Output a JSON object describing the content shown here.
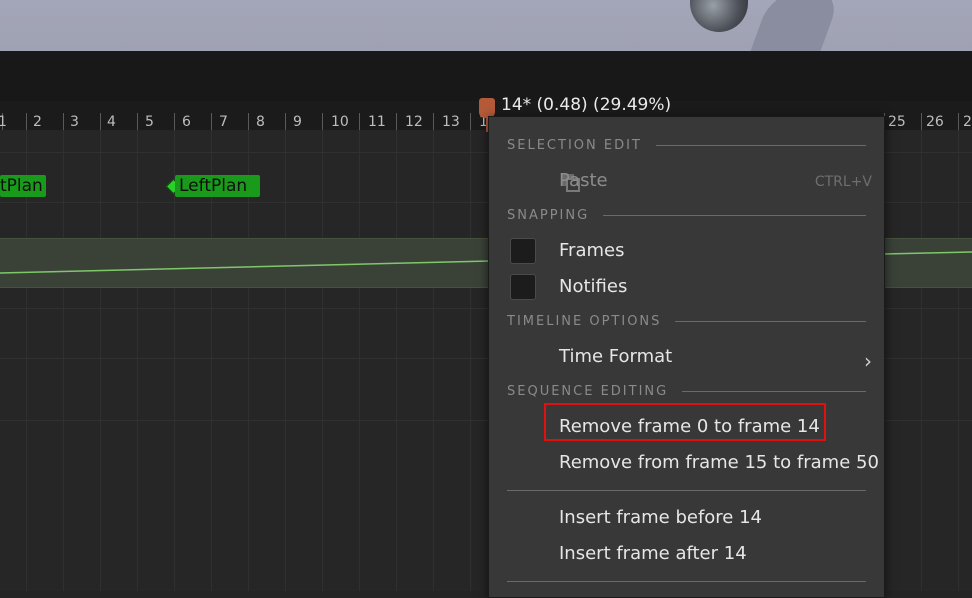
{
  "timeline": {
    "ruler_labels": [
      "1",
      "2",
      "3",
      "4",
      "5",
      "6",
      "7",
      "8",
      "9",
      "10",
      "11",
      "12",
      "13",
      "1",
      "25",
      "26",
      "2"
    ],
    "scrubber_readout": "14* (0.48) (29.49%)",
    "notifies": [
      "tPlan",
      "LeftPlan"
    ]
  },
  "menu": {
    "sections": {
      "selection_edit": "SELECTION EDIT",
      "snapping": "SNAPPING",
      "timeline_options": "TIMELINE OPTIONS",
      "sequence_editing": "SEQUENCE EDITING"
    },
    "paste": {
      "label": "Paste",
      "shortcut": "CTRL+V",
      "enabled": false
    },
    "snap_frames": {
      "label": "Frames",
      "checked": false
    },
    "snap_notifies": {
      "label": "Notifies",
      "checked": false
    },
    "time_format": "Time Format",
    "remove_frame_0_to_14": "Remove frame 0 to frame 14",
    "remove_from_15_to_50": "Remove from frame 15 to frame 50",
    "insert_before": "Insert frame before 14",
    "insert_after": "Insert frame after 14"
  },
  "colors": {
    "scrubber": "#b45a38",
    "notify_green": "#1a9a1a",
    "highlight": "#e01010"
  }
}
